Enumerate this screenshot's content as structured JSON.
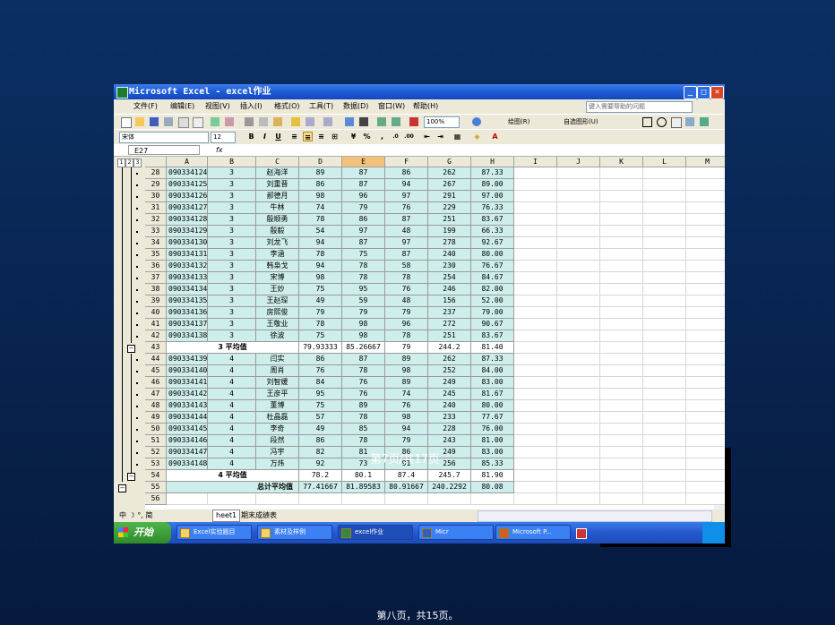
{
  "window": {
    "title": "Microsoft Excel - excel作业"
  },
  "menu": [
    "文件(F)",
    "编辑(E)",
    "视图(V)",
    "插入(I)",
    "格式(O)",
    "工具(T)",
    "数据(D)",
    "窗口(W)",
    "帮助(H)"
  ],
  "help_placeholder": "键入需要帮助的问题",
  "toolbar": {
    "zoom": "100%",
    "drawing": "绘图(R)",
    "autoshape": "自选图形(U)"
  },
  "format_bar": {
    "font": "宋体",
    "size": "12",
    "bold": "B",
    "italic": "I",
    "underline": "U",
    "percent": "%"
  },
  "formula": {
    "namebox": "E27",
    "fx": "fx"
  },
  "outline_levels": [
    "1",
    "2",
    "3"
  ],
  "columns": [
    "A",
    "B",
    "C",
    "D",
    "E",
    "F",
    "G",
    "H",
    "I",
    "J",
    "K",
    "L",
    "M"
  ],
  "selected_column": "E",
  "rows": [
    {
      "n": "28",
      "a": "090334124",
      "b": "3",
      "c": "赵海洋",
      "d": "89",
      "e": "87",
      "f": "86",
      "g": "262",
      "h": "87.33"
    },
    {
      "n": "29",
      "a": "090334125",
      "b": "3",
      "c": "刘重晋",
      "d": "86",
      "e": "87",
      "f": "94",
      "g": "267",
      "h": "89.00"
    },
    {
      "n": "30",
      "a": "090334126",
      "b": "3",
      "c": "郝德月",
      "d": "98",
      "e": "96",
      "f": "97",
      "g": "291",
      "h": "97.00"
    },
    {
      "n": "31",
      "a": "090334127",
      "b": "3",
      "c": "牛林",
      "d": "74",
      "e": "79",
      "f": "76",
      "g": "229",
      "h": "76.33"
    },
    {
      "n": "32",
      "a": "090334128",
      "b": "3",
      "c": "殷顺勇",
      "d": "78",
      "e": "86",
      "f": "87",
      "g": "251",
      "h": "83.67"
    },
    {
      "n": "33",
      "a": "090334129",
      "b": "3",
      "c": "殷毅",
      "d": "54",
      "e": "97",
      "f": "48",
      "g": "199",
      "h": "66.33"
    },
    {
      "n": "34",
      "a": "090334130",
      "b": "3",
      "c": "刘龙飞",
      "d": "94",
      "e": "87",
      "f": "97",
      "g": "278",
      "h": "92.67"
    },
    {
      "n": "35",
      "a": "090334131",
      "b": "3",
      "c": "李涵",
      "d": "78",
      "e": "75",
      "f": "87",
      "g": "240",
      "h": "80.00"
    },
    {
      "n": "36",
      "a": "090334132",
      "b": "3",
      "c": "韩枭戈",
      "d": "94",
      "e": "78",
      "f": "58",
      "g": "230",
      "h": "76.67"
    },
    {
      "n": "37",
      "a": "090334133",
      "b": "3",
      "c": "宋博",
      "d": "98",
      "e": "78",
      "f": "78",
      "g": "254",
      "h": "84.67"
    },
    {
      "n": "38",
      "a": "090334134",
      "b": "3",
      "c": "王妙",
      "d": "75",
      "e": "95",
      "f": "76",
      "g": "246",
      "h": "82.00"
    },
    {
      "n": "39",
      "a": "090334135",
      "b": "3",
      "c": "王赵琛",
      "d": "49",
      "e": "59",
      "f": "48",
      "g": "156",
      "h": "52.00"
    },
    {
      "n": "40",
      "a": "090334136",
      "b": "3",
      "c": "房熙俊",
      "d": "79",
      "e": "79",
      "f": "79",
      "g": "237",
      "h": "79.00"
    },
    {
      "n": "41",
      "a": "090334137",
      "b": "3",
      "c": "王敬业",
      "d": "78",
      "e": "98",
      "f": "96",
      "g": "272",
      "h": "90.67"
    },
    {
      "n": "42",
      "a": "090334138",
      "b": "3",
      "c": "徐波",
      "d": "75",
      "e": "98",
      "f": "78",
      "g": "251",
      "h": "83.67"
    },
    {
      "n": "43",
      "summary": "3 平均值",
      "d": "79.93333",
      "e": "85.26667",
      "f": "79",
      "g": "244.2",
      "h": "81.40"
    },
    {
      "n": "44",
      "a": "090334139",
      "b": "4",
      "c": "闫实",
      "d": "86",
      "e": "87",
      "f": "89",
      "g": "262",
      "h": "87.33"
    },
    {
      "n": "45",
      "a": "090334140",
      "b": "4",
      "c": "周肖",
      "d": "76",
      "e": "78",
      "f": "98",
      "g": "252",
      "h": "84.00"
    },
    {
      "n": "46",
      "a": "090334141",
      "b": "4",
      "c": "刘智媛",
      "d": "84",
      "e": "76",
      "f": "89",
      "g": "249",
      "h": "83.00"
    },
    {
      "n": "47",
      "a": "090334142",
      "b": "4",
      "c": "王彦平",
      "d": "95",
      "e": "76",
      "f": "74",
      "g": "245",
      "h": "81.67"
    },
    {
      "n": "48",
      "a": "090334143",
      "b": "4",
      "c": "董博",
      "d": "75",
      "e": "89",
      "f": "76",
      "g": "240",
      "h": "80.00"
    },
    {
      "n": "49",
      "a": "090334144",
      "b": "4",
      "c": "杜晶磊",
      "d": "57",
      "e": "78",
      "f": "98",
      "g": "233",
      "h": "77.67"
    },
    {
      "n": "50",
      "a": "090334145",
      "b": "4",
      "c": "李奇",
      "d": "49",
      "e": "85",
      "f": "94",
      "g": "228",
      "h": "76.00"
    },
    {
      "n": "51",
      "a": "090334146",
      "b": "4",
      "c": "段然",
      "d": "86",
      "e": "78",
      "f": "79",
      "g": "243",
      "h": "81.00"
    },
    {
      "n": "52",
      "a": "090334147",
      "b": "4",
      "c": "冯宇",
      "d": "82",
      "e": "81",
      "f": "86",
      "g": "249",
      "h": "83.00"
    },
    {
      "n": "53",
      "a": "090334148",
      "b": "4",
      "c": "万炜",
      "d": "92",
      "e": "73",
      "f": "91",
      "g": "256",
      "h": "85.33"
    },
    {
      "n": "54",
      "summary": "4 平均值",
      "d": "78.2",
      "e": "80.1",
      "f": "87.4",
      "g": "245.7",
      "h": "81.90"
    },
    {
      "n": "55",
      "summary": "总计平均值",
      "d": "77.41667",
      "e": "81.89583",
      "f": "80.91667",
      "g": "240.2292",
      "h": "80.08"
    },
    {
      "n": "56"
    }
  ],
  "sheet_tabs": [
    "heet1",
    "期末成绩表"
  ],
  "ime": "中 ☽ °, 简",
  "taskbar": {
    "start": "开始",
    "items": [
      "Excel实验题目",
      "素材及样例",
      "excel作业",
      "Micr",
      "Microsoft P..."
    ]
  },
  "overlay_text": "第7页/共17页",
  "slide_footer": "第八页，共15页。",
  "colors": {
    "teal_cell": "#cdeeea",
    "slide_bg": "#0b2f63",
    "taskbar": "#2458cf"
  }
}
